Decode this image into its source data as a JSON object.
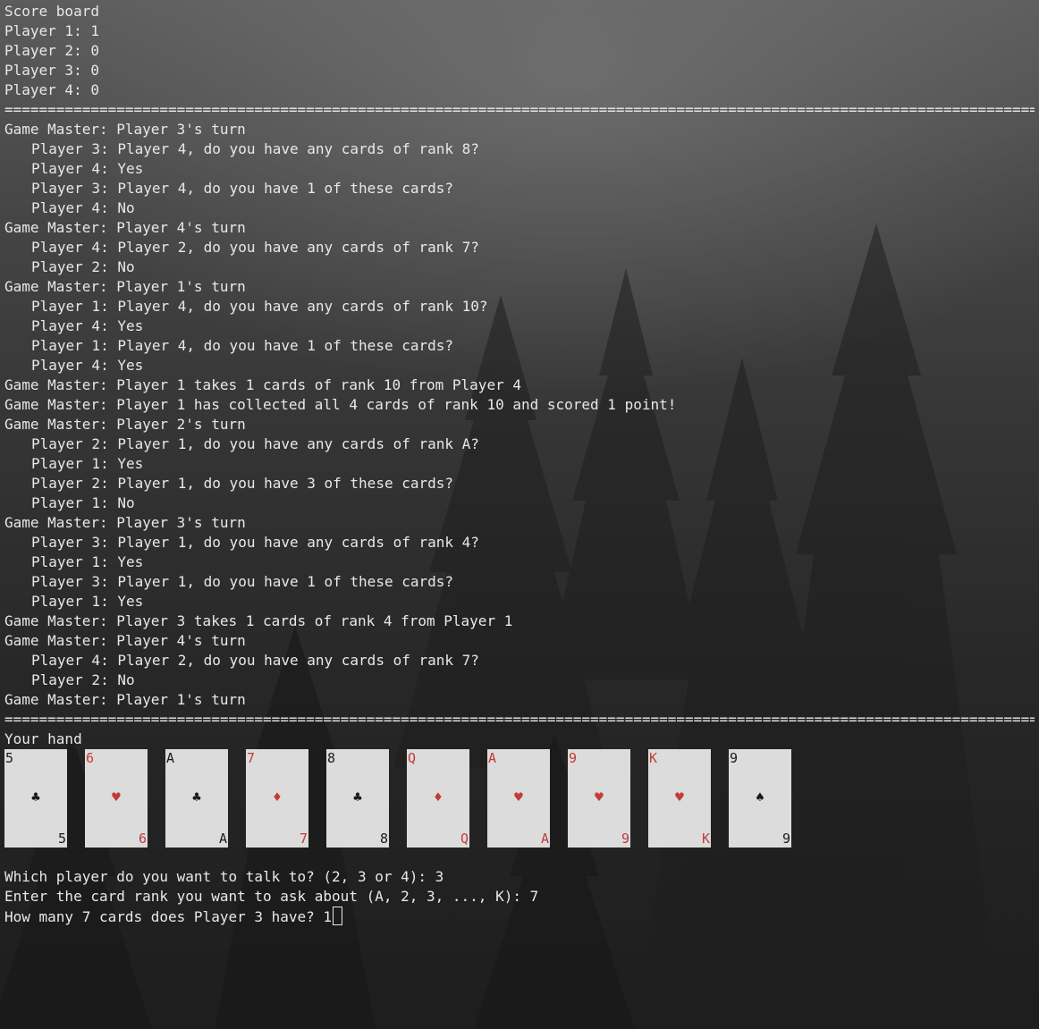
{
  "scoreboard": {
    "title": "Score board",
    "players": [
      "Player 1: 1",
      "Player 2: 0",
      "Player 3: 0",
      "Player 4: 0"
    ]
  },
  "separator": "================================================================================================================================",
  "log": [
    {
      "indent": false,
      "text": "Game Master: Player 3's turn"
    },
    {
      "indent": true,
      "text": "Player 3: Player 4, do you have any cards of rank 8?"
    },
    {
      "indent": true,
      "text": "Player 4: Yes"
    },
    {
      "indent": true,
      "text": "Player 3: Player 4, do you have 1 of these cards?"
    },
    {
      "indent": true,
      "text": "Player 4: No"
    },
    {
      "indent": false,
      "text": "Game Master: Player 4's turn"
    },
    {
      "indent": true,
      "text": "Player 4: Player 2, do you have any cards of rank 7?"
    },
    {
      "indent": true,
      "text": "Player 2: No"
    },
    {
      "indent": false,
      "text": "Game Master: Player 1's turn"
    },
    {
      "indent": true,
      "text": "Player 1: Player 4, do you have any cards of rank 10?"
    },
    {
      "indent": true,
      "text": "Player 4: Yes"
    },
    {
      "indent": true,
      "text": "Player 1: Player 4, do you have 1 of these cards?"
    },
    {
      "indent": true,
      "text": "Player 4: Yes"
    },
    {
      "indent": false,
      "text": "Game Master: Player 1 takes 1 cards of rank 10 from Player 4"
    },
    {
      "indent": false,
      "text": "Game Master: Player 1 has collected all 4 cards of rank 10 and scored 1 point!"
    },
    {
      "indent": false,
      "text": "Game Master: Player 2's turn"
    },
    {
      "indent": true,
      "text": "Player 2: Player 1, do you have any cards of rank A?"
    },
    {
      "indent": true,
      "text": "Player 1: Yes"
    },
    {
      "indent": true,
      "text": "Player 2: Player 1, do you have 3 of these cards?"
    },
    {
      "indent": true,
      "text": "Player 1: No"
    },
    {
      "indent": false,
      "text": "Game Master: Player 3's turn"
    },
    {
      "indent": true,
      "text": "Player 3: Player 1, do you have any cards of rank 4?"
    },
    {
      "indent": true,
      "text": "Player 1: Yes"
    },
    {
      "indent": true,
      "text": "Player 3: Player 1, do you have 1 of these cards?"
    },
    {
      "indent": true,
      "text": "Player 1: Yes"
    },
    {
      "indent": false,
      "text": "Game Master: Player 3 takes 1 cards of rank 4 from Player 1"
    },
    {
      "indent": false,
      "text": "Game Master: Player 4's turn"
    },
    {
      "indent": true,
      "text": "Player 4: Player 2, do you have any cards of rank 7?"
    },
    {
      "indent": true,
      "text": "Player 2: No"
    },
    {
      "indent": false,
      "text": "Game Master: Player 1's turn"
    }
  ],
  "hand": {
    "title": "Your hand",
    "cards": [
      {
        "rank": "5",
        "suit": "♣",
        "color": "black"
      },
      {
        "rank": "6",
        "suit": "♥",
        "color": "red"
      },
      {
        "rank": "A",
        "suit": "♣",
        "color": "black"
      },
      {
        "rank": "7",
        "suit": "♦",
        "color": "red"
      },
      {
        "rank": "8",
        "suit": "♣",
        "color": "black"
      },
      {
        "rank": "Q",
        "suit": "♦",
        "color": "red"
      },
      {
        "rank": "A",
        "suit": "♥",
        "color": "red"
      },
      {
        "rank": "9",
        "suit": "♥",
        "color": "red"
      },
      {
        "rank": "K",
        "suit": "♥",
        "color": "red"
      },
      {
        "rank": "9",
        "suit": "♠",
        "color": "black"
      }
    ]
  },
  "prompts": [
    "Which player do you want to talk to? (2, 3 or 4): 3",
    "Enter the card rank you want to ask about (A, 2, 3, ..., K): 7"
  ],
  "current_prompt": "How many 7 cards does Player 3 have? 1",
  "colors": {
    "text": "#e8e8e8",
    "card_bg": "#dcdcdc",
    "card_red": "#c43a3a",
    "card_black": "#1a1a1a"
  }
}
